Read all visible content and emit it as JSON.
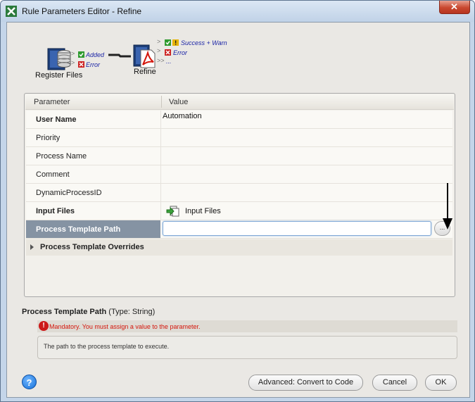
{
  "window": {
    "title": "Rule Parameters Editor - Refine",
    "close_glyph": "✕"
  },
  "workflow": {
    "register": {
      "label": "Register Files",
      "ports": [
        "Added",
        "Error"
      ],
      "icon": "database-icon"
    },
    "refine": {
      "label": "Refine",
      "ports": [
        "Success + Warn",
        "Error",
        "..."
      ],
      "icon": "pdf-refine-icon"
    }
  },
  "grid": {
    "header": {
      "parameter": "Parameter",
      "value": "Value"
    },
    "rows": [
      {
        "name": "User Name",
        "value": "Automation"
      },
      {
        "name": "Priority",
        "value": ""
      },
      {
        "name": "Process Name",
        "value": ""
      },
      {
        "name": "Comment",
        "value": ""
      },
      {
        "name": "DynamicProcessID",
        "value": ""
      },
      {
        "name": "Input Files",
        "value": "Input Files"
      }
    ],
    "selected_row": {
      "name": "Process Template Path",
      "value": "",
      "browse_label": "..."
    },
    "group": {
      "name": "Process Template Overrides"
    }
  },
  "description": {
    "title": "Process Template Path",
    "type": "(Type: String)",
    "mandatory_message": "Mandatory. You must assign a value to the parameter.",
    "text": "The path to the process template to execute."
  },
  "buttons": {
    "help": "?",
    "advanced": "Advanced: Convert to Code",
    "cancel": "Cancel",
    "ok": "OK"
  },
  "colors": {
    "selected_row": "#8593a3",
    "error": "#d4160b",
    "port_text": "#1b24a6"
  }
}
